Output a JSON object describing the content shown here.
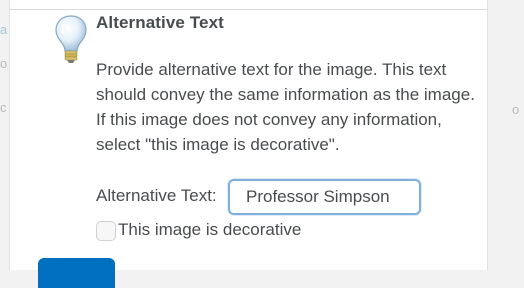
{
  "dialog": {
    "title": "Alternative Text",
    "description": "Provide alternative text for the image. This text should convey the same information as the image. If this image does not convey any information, select \"this image is decorative\".",
    "alt_text": {
      "label": "Alternative Text:",
      "value": "Professor Simpson"
    },
    "decorative": {
      "label": "This image is decorative",
      "checked": false
    },
    "icon": "lightbulb-icon"
  },
  "colors": {
    "accent": "#006fbf",
    "text": "#494c4e",
    "input_focus_border": "#7fb0dc"
  }
}
